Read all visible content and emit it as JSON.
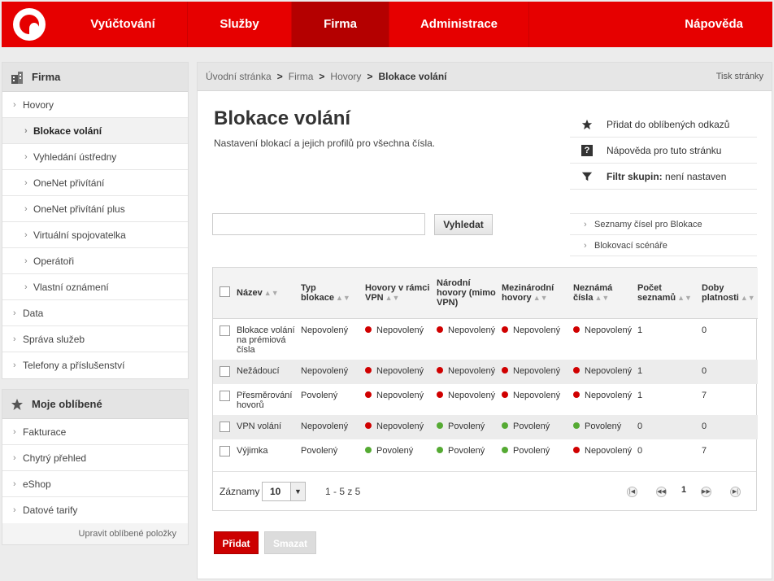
{
  "nav": {
    "items": [
      {
        "label": "Vyúčtování"
      },
      {
        "label": "Služby"
      },
      {
        "label": "Firma"
      },
      {
        "label": "Administrace"
      },
      {
        "label": "Nápověda"
      }
    ],
    "active": "Firma",
    "brand_color": "#e60000"
  },
  "sidebar": {
    "firma": {
      "title": "Firma",
      "items": [
        {
          "label": "Hovory"
        },
        {
          "label": "Blokace volání"
        },
        {
          "label": "Vyhledání ústředny"
        },
        {
          "label": "OneNet přivítání"
        },
        {
          "label": "OneNet přivítání plus"
        },
        {
          "label": "Virtuální spojovatelka"
        },
        {
          "label": "Operátoři"
        },
        {
          "label": "Vlastní oznámení"
        },
        {
          "label": "Data"
        },
        {
          "label": "Správa služeb"
        },
        {
          "label": "Telefony a příslušenství"
        }
      ]
    },
    "favorites": {
      "title": "Moje oblíbené",
      "items": [
        {
          "label": "Fakturace"
        },
        {
          "label": "Chytrý přehled"
        },
        {
          "label": "eShop"
        },
        {
          "label": "Datové tarify"
        }
      ],
      "edit_label": "Upravit oblíbené položky"
    }
  },
  "breadcrumb": {
    "items": [
      "Úvodní stránka",
      "Firma",
      "Hovory",
      "Blokace volání"
    ],
    "separator": ">",
    "print_label": "Tisk stránky"
  },
  "page": {
    "title": "Blokace volání",
    "subtitle": "Nastavení blokací a jejich profilů pro všechna čísla."
  },
  "actions": {
    "favorite": "Přidat do oblíbených odkazů",
    "help": "Nápověda pro tuto stránku",
    "filter_label": "Filtr skupin:",
    "filter_value": "není nastaven"
  },
  "search": {
    "value": "",
    "button_label": "Vyhledat"
  },
  "links": [
    {
      "label": "Seznamy čísel pro Blokace"
    },
    {
      "label": "Blokovací scénáře"
    }
  ],
  "table": {
    "headers": {
      "name": "Název",
      "type": "Typ blokace",
      "vpn": "Hovory v rámci VPN",
      "national": "Národní hovory (mimo VPN)",
      "international": "Mezinárodní hovory",
      "unknown": "Neznámá čísla",
      "lists": "Počet seznamů",
      "validity": "Doby platnosti"
    },
    "rows": [
      {
        "name": "Blokace volání na prémiová čísla",
        "type": "Nepovolený",
        "vpn": "Nepovolený",
        "national": "Nepovolený",
        "international": "Nepovolený",
        "unknown": "Nepovolený",
        "lists": "1",
        "validity": "0"
      },
      {
        "name": "Nežádoucí",
        "type": "Nepovolený",
        "vpn": "Nepovolený",
        "national": "Nepovolený",
        "international": "Nepovolený",
        "unknown": "Nepovolený",
        "lists": "1",
        "validity": "0"
      },
      {
        "name": "Přesměrování hovorů",
        "type": "Povolený",
        "vpn": "Nepovolený",
        "national": "Nepovolený",
        "international": "Nepovolený",
        "unknown": "Nepovolený",
        "lists": "1",
        "validity": "7"
      },
      {
        "name": "VPN volání",
        "type": "Nepovolený",
        "vpn": "Nepovolený",
        "national": "Povolený",
        "international": "Povolený",
        "unknown": "Povolený",
        "lists": "0",
        "validity": "0"
      },
      {
        "name": "Výjimka",
        "type": "Povolený",
        "vpn": "Povolený",
        "national": "Povolený",
        "international": "Povolený",
        "unknown": "Nepovolený",
        "lists": "0",
        "validity": "7"
      }
    ],
    "status_colors": {
      "Povolený": "#55aa33",
      "Nepovolený": "#d00000"
    }
  },
  "pager": {
    "label": "Záznamy",
    "page_size": "10",
    "range": "1 - 5 z 5",
    "current_page": "1"
  },
  "buttons": {
    "add": "Přidat",
    "delete": "Smazat"
  }
}
